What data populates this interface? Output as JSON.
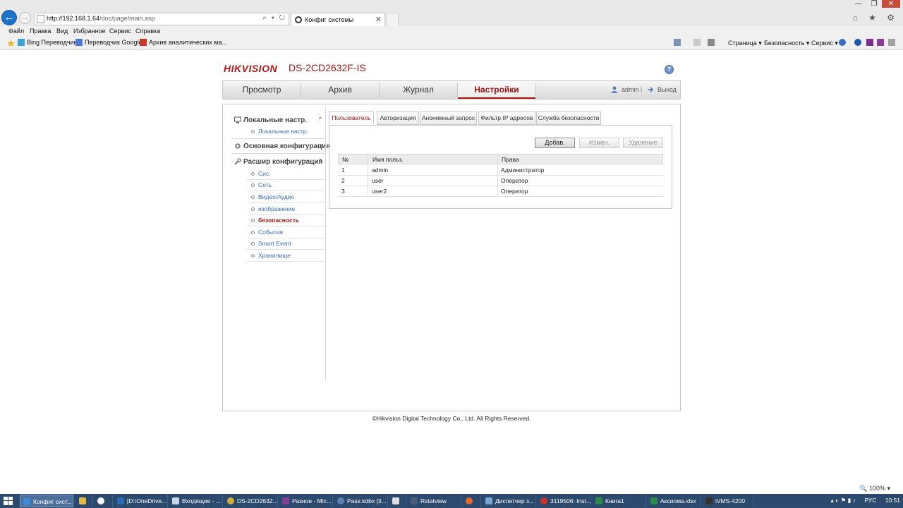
{
  "browser": {
    "url_host": "http://192.168.1.64",
    "url_path": "/doc/page/main.asp",
    "addr_tools": "⌕ ▾ ↻",
    "tab_title": "Конфиг системы",
    "tab_close": "✕",
    "window_controls": [
      "—",
      "❐",
      "✕"
    ],
    "right_icons": "⌂ ★ ⚙",
    "menu": [
      "Файл",
      "Правка",
      "Вид",
      "Избранное",
      "Сервис",
      "Справка"
    ],
    "favorites": [
      "Bing Переводчик",
      "Переводчик Google",
      "Архив аналитических ма..."
    ],
    "commands": [
      "Страница ▾",
      "Безопасность ▾",
      "Сервис ▾"
    ],
    "zoom": "🔍 100% ▾"
  },
  "header": {
    "logo": "HIKVISION",
    "model": "DS-2CD2632F-IS",
    "help": "?"
  },
  "nav": {
    "items": [
      "Просмотр",
      "Архив",
      "Журнал",
      "Настройки"
    ],
    "active": 3,
    "user": "admin",
    "separator": "|",
    "logout": "Выход"
  },
  "sidebar": {
    "groups": [
      {
        "label": "Локальные настр.",
        "chevron": "^",
        "items": [
          "Локальные настр."
        ]
      },
      {
        "label": "Основная конфигурация",
        "chevron": "v",
        "items": []
      },
      {
        "label": "Расшир конфигурация",
        "chevron": "^",
        "items": [
          "Сис.",
          "Сеть",
          "Видео/Аудио",
          "изображение",
          "безопасность",
          "События",
          "Smart Event",
          "Хранилище"
        ]
      }
    ],
    "active_item": "безопасность"
  },
  "tabs": [
    "Пользователь",
    "Авторизация",
    "Анонимный запрос",
    "Фильтр IP адресов",
    "Служба безопасности"
  ],
  "active_tab": 0,
  "buttons": {
    "add": "Добав.",
    "edit": "Измен.",
    "delete": "Удаление"
  },
  "table": {
    "headers": [
      "№",
      "Имя польз.",
      "Права"
    ],
    "rows": [
      [
        "1",
        "admin",
        "Администратор"
      ],
      [
        "2",
        "user",
        "Оператор"
      ],
      [
        "3",
        "user2",
        "Оператор"
      ]
    ]
  },
  "footer": "©Hikvision Digital Technology Co., Ltd. All Rights Reserved.",
  "taskbar": {
    "items": [
      "Конфиг сист...",
      "",
      "",
      "[D:\\OneDrive...",
      "Входящие - ...",
      "DS-2CD2632...",
      "Разное - Mic...",
      "Pass.kdbx [3...",
      "",
      "Rstatview",
      "",
      "Диспетчер з...",
      "3119506: Inst...",
      "Книга1",
      "Аксиома.xlsx",
      "iVMS-4200"
    ],
    "tray_lang": "РУС",
    "tray_time": "10:51"
  }
}
